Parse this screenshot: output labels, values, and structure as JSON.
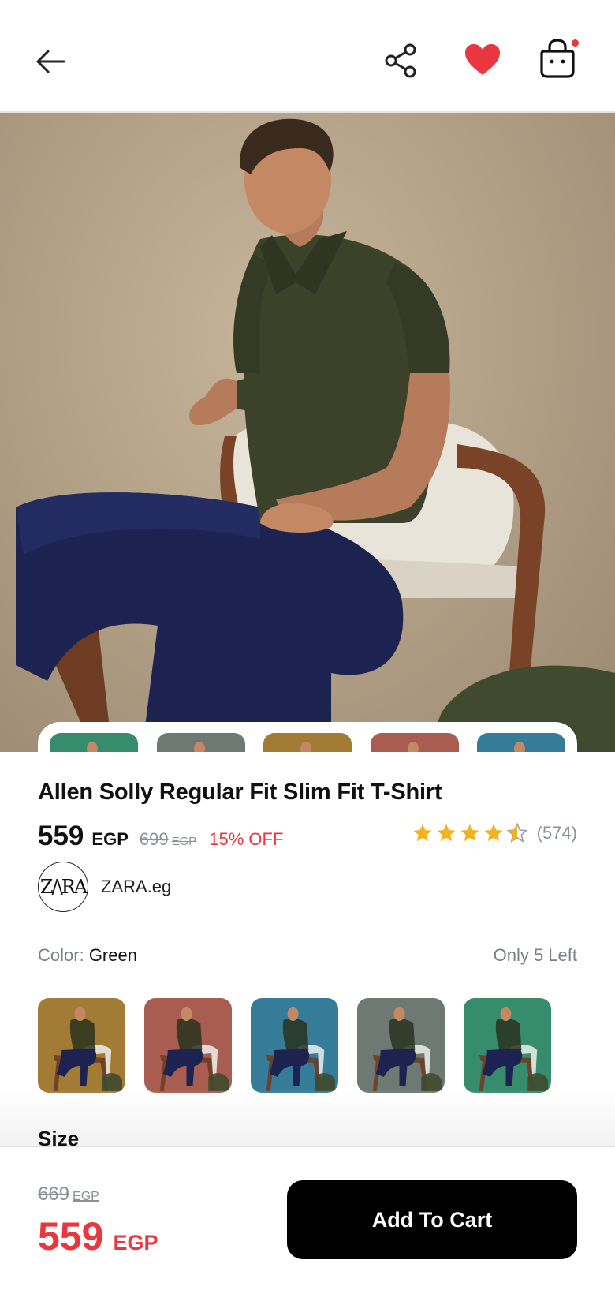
{
  "header": {
    "icons": [
      "back-arrow-icon",
      "share-icon",
      "heart-icon",
      "shopping-bag-icon"
    ],
    "favorite_color": "#e8373e",
    "cart_badge_color": "#e8373e"
  },
  "gallery": {
    "thumbnails": [
      {
        "tint": "#3fa07e"
      },
      {
        "tint": "#7e8a84"
      },
      {
        "tint": "#b98c3c"
      },
      {
        "tint": "#c06a5c"
      },
      {
        "tint": "#3d8eae"
      }
    ]
  },
  "product": {
    "title": "Allen Solly Regular Fit Slim Fit T-Shirt",
    "price": "559",
    "currency": "EGP",
    "old_price": "699",
    "old_currency": "EGP",
    "discount": "15% OFF",
    "rating": 4.5,
    "rating_count": "(574)",
    "seller_logo_text": "ZARA",
    "seller_name": "ZARA.eg"
  },
  "color": {
    "label": "Color:",
    "value": "Green",
    "stock": "Only 5 Left",
    "swatches": [
      {
        "tint": "#b98c3c"
      },
      {
        "tint": "#c06a5c"
      },
      {
        "tint": "#3d8eae"
      },
      {
        "tint": "#7e8a84"
      },
      {
        "tint": "#3fa07e"
      }
    ]
  },
  "size": {
    "label": "Size"
  },
  "bottom_bar": {
    "old_price": "669",
    "old_currency": "EGP",
    "price": "559",
    "currency": "EGP",
    "add_to_cart_label": "Add To Cart"
  },
  "colors": {
    "accent_red": "#e8373e",
    "star_gold": "#f0b323",
    "button_black": "#000000"
  }
}
